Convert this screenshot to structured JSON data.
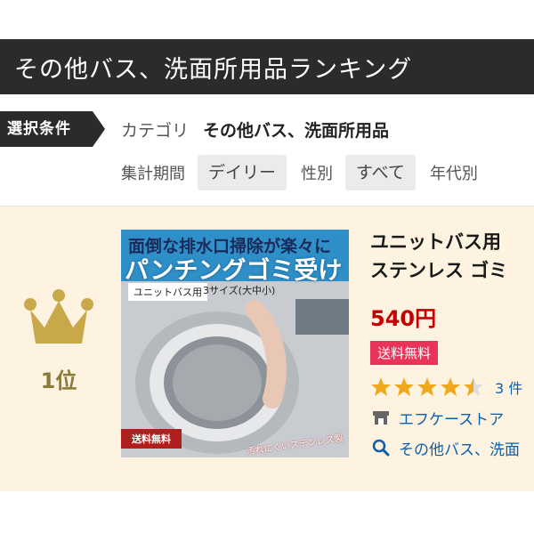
{
  "header": {
    "title": "その他バス、洗面所用品ランキング"
  },
  "conditions": {
    "label": "選択条件",
    "category_key": "カテゴリ",
    "category_value": "その他バス、洗面所用品",
    "period_key": "集計期間",
    "period_value": "デイリー",
    "gender_key": "性別",
    "gender_value": "すべて",
    "age_key": "年代別"
  },
  "items": [
    {
      "rank_label": "1位",
      "product_name_line1": "ユニットバス用",
      "product_name_line2": "ステンレス ゴミ",
      "price": "540円",
      "shipping_badge": "送料無料",
      "rating": 4.5,
      "review_count": "3 件",
      "shop_name": "エフケーストア",
      "category_link": "その他バス、洗面",
      "image": {
        "caption1": "面倒な排水口掃除が楽々に",
        "caption2": "パンチングゴミ受け",
        "caption3": "ユニットバス用",
        "caption4": "3サイズ(大中小)",
        "badge": "送料無料",
        "note": "汚れにくいステンレス製"
      },
      "icons": {
        "rank": "crown-icon",
        "shop": "shop-icon",
        "category": "search-icon"
      }
    }
  ],
  "colors": {
    "header_bg": "#2b2b2b",
    "item_bg": "#fdf3e0",
    "crown": "#c9a84a",
    "price": "#c40000",
    "shipping_badge": "#e8335a",
    "star": "#f0a81c",
    "link": "#0b5fad"
  }
}
